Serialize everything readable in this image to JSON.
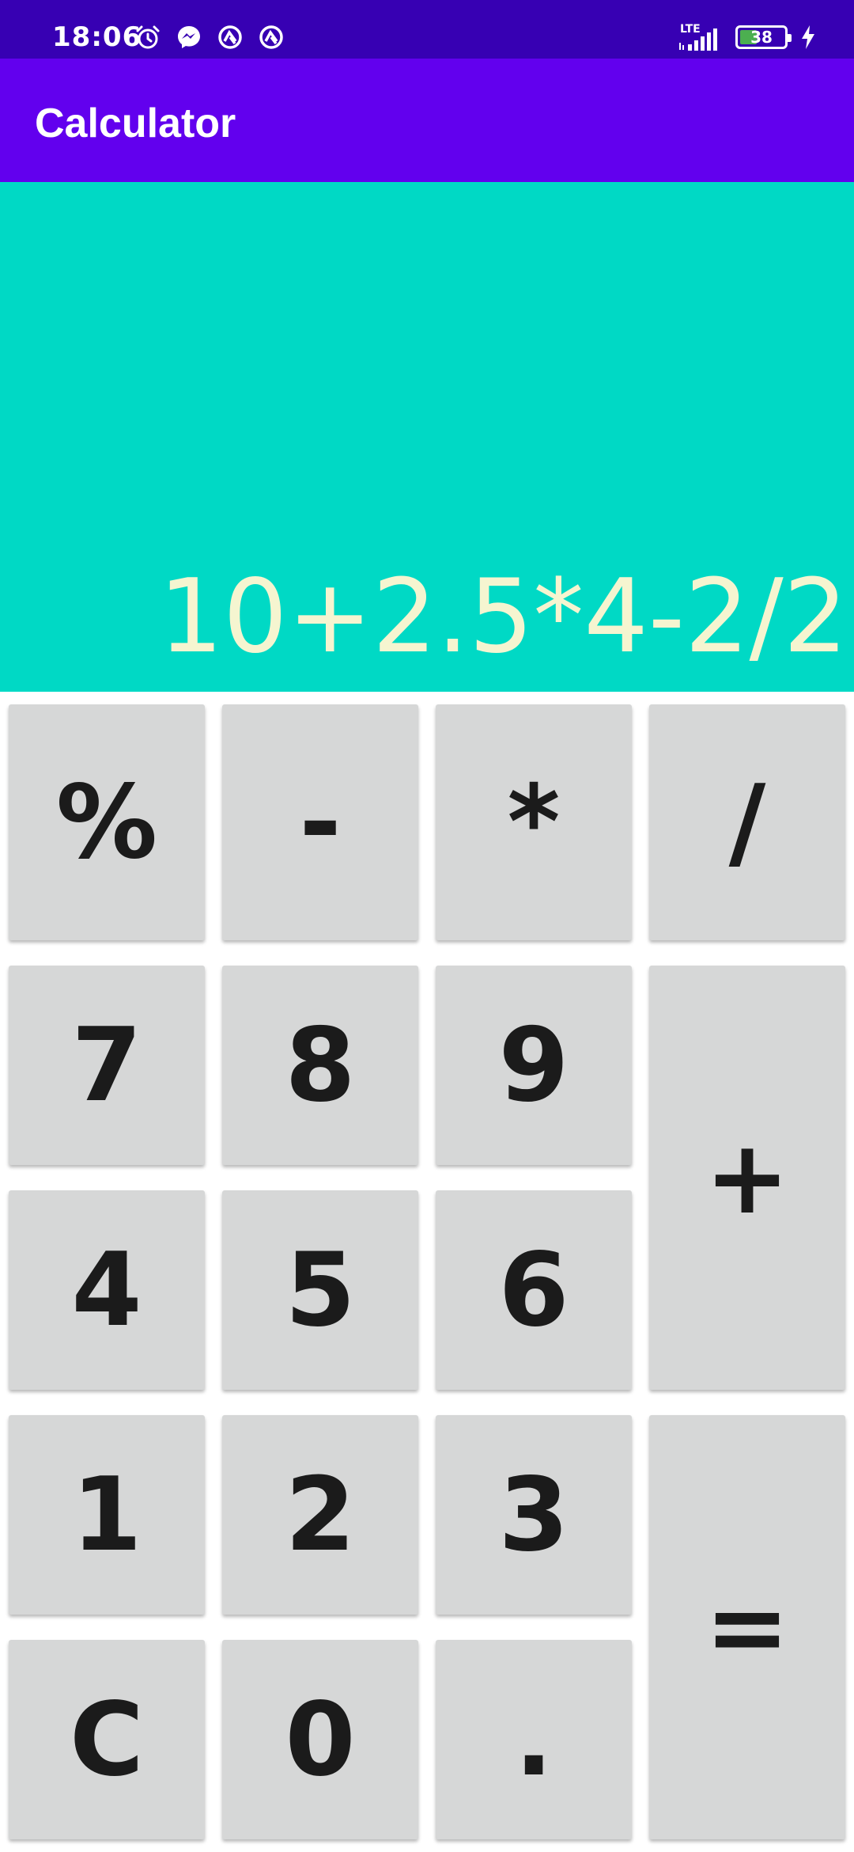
{
  "status_bar": {
    "time": "18:06",
    "network": "LTE",
    "battery_level": "38",
    "battery_fraction": 0.38,
    "notification_icons": [
      "alarm-icon",
      "messenger-icon",
      "app-notification-icon",
      "app-notification-icon"
    ],
    "colors": {
      "background": "#3700b3"
    }
  },
  "app_bar": {
    "title": "Calculator",
    "colors": {
      "background": "#6200ee"
    }
  },
  "display": {
    "expression": "10+2.5*4-2/2",
    "colors": {
      "background": "#00d9c5",
      "text": "#f5f5d0"
    }
  },
  "keypad": {
    "colors": {
      "key": "#d6d7d7",
      "label": "#1b1b1b"
    },
    "keys": {
      "percent": "%",
      "minus": "-",
      "multiply": "*",
      "divide": "/",
      "seven": "7",
      "eight": "8",
      "nine": "9",
      "plus": "+",
      "four": "4",
      "five": "5",
      "six": "6",
      "one": "1",
      "two": "2",
      "three": "3",
      "equals": "=",
      "clear": "C",
      "zero": "0",
      "decimal": "."
    }
  }
}
